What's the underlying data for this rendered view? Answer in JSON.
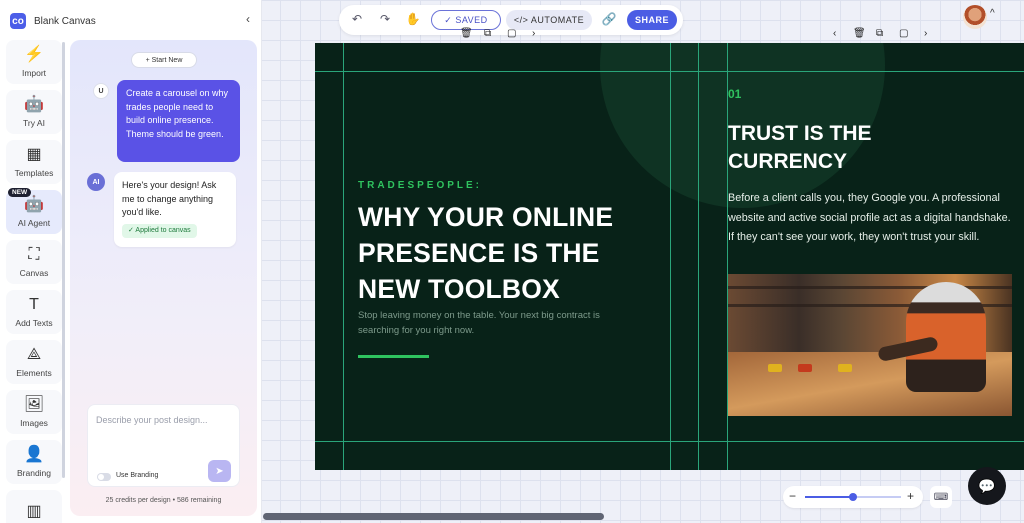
{
  "sidebar": {
    "title": "Blank Canvas",
    "logo_text": "co",
    "collapse_icon": "chevron-left",
    "items": [
      {
        "label": "Import",
        "icon": "⚡"
      },
      {
        "label": "Try AI",
        "icon": "🤖"
      },
      {
        "label": "Templates",
        "icon": "▦"
      },
      {
        "label": "AI Agent",
        "icon": "🤖",
        "badge": "NEW"
      },
      {
        "label": "Canvas",
        "icon": "⛶"
      },
      {
        "label": "Add Texts",
        "icon": "T"
      },
      {
        "label": "Elements",
        "icon": "⟁"
      },
      {
        "label": "Images",
        "icon": "🖼"
      },
      {
        "label": "Branding",
        "icon": "👤"
      },
      {
        "label": "",
        "icon": "▥"
      }
    ]
  },
  "chat": {
    "start_new": "+ Start New",
    "user_avatar": "U",
    "user_message": "Create a carousel on why trades people need to build online presence. Theme should be green.",
    "ai_avatar": "AI",
    "ai_message": "Here's your design! Ask me to change anything you'd like.",
    "applied_label": "✓ Applied to canvas",
    "composer_placeholder": "Describe your post design...",
    "branding_label": "Use Branding",
    "credits": "25 credits per design • 586 remaining"
  },
  "toolbar": {
    "undo_icon": "↶",
    "redo_icon": "↷",
    "hand_icon": "✋",
    "saved_label": "✓ SAVED",
    "automate_label": "</> AUTOMATE",
    "link_icon": "🔗",
    "share_label": "SHARE"
  },
  "slide_controls": {
    "left": [
      "🗑",
      "⧉",
      "▢",
      "›"
    ],
    "right": [
      "‹",
      "🗑",
      "⧉",
      "▢",
      "›"
    ]
  },
  "slide1": {
    "eyebrow": "TRADESPEOPLE:",
    "headline": "WHY YOUR ONLINE PRESENCE IS THE NEW TOOLBOX",
    "sub": "Stop leaving money on the table. Your next big contract is searching for you right now."
  },
  "slide2": {
    "number": "01",
    "title": "TRUST IS THE CURRENCY",
    "body": "Before a client calls you, they Google you. A professional website and active social profile act as a digital handshake. If they can't see your work, they won't trust your skill."
  },
  "zoom": {
    "minus": "−",
    "plus": "+",
    "level": 0.5
  },
  "colors": {
    "accent": "#4b5de4",
    "canvas_bg": "#082218",
    "green": "#2fc35f"
  }
}
